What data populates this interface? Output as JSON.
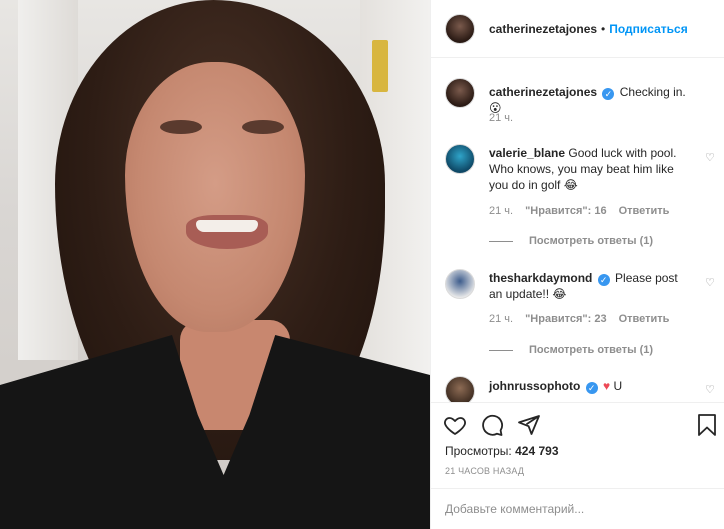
{
  "header": {
    "username": "catherinezetajones",
    "separator": "•",
    "follow_label": "Подписаться"
  },
  "caption": {
    "username": "catherinezetajones",
    "verified_mark": "✓",
    "text": "Checking in.😮",
    "time": "21 ч."
  },
  "comments": [
    {
      "username": "valerie_blane",
      "text": "Good luck with pool. Who knows, you may beat him like you do in golf 😂",
      "time": "21 ч.",
      "likes": "\"Нравится\": 16",
      "reply": "Ответить",
      "view_replies": "Посмотреть ответы (1)"
    },
    {
      "username": "thesharkdaymond",
      "verified_mark": "✓",
      "text": "Please post an update!! 😂",
      "time": "21 ч.",
      "likes": "\"Нравится\": 23",
      "reply": "Ответить",
      "view_replies": "Посмотреть ответы (1)"
    },
    {
      "username": "johnrussophoto",
      "verified_mark": "✓",
      "heart": "♥",
      "text": "U"
    }
  ],
  "icons": {
    "like": "heart-outline-icon",
    "comment": "comment-icon",
    "share": "paper-plane-icon",
    "save": "bookmark-icon",
    "comment_like": "♡"
  },
  "stats": {
    "views_label": "Просмотры:",
    "views_value": "424 793",
    "time_ago": "21 часов назад"
  },
  "composer": {
    "placeholder": "Добавьте комментарий..."
  },
  "colors": {
    "accent": "#0095f6",
    "verified": "#3897f0",
    "muted": "#8e8e8e",
    "heart": "#ed4956"
  }
}
